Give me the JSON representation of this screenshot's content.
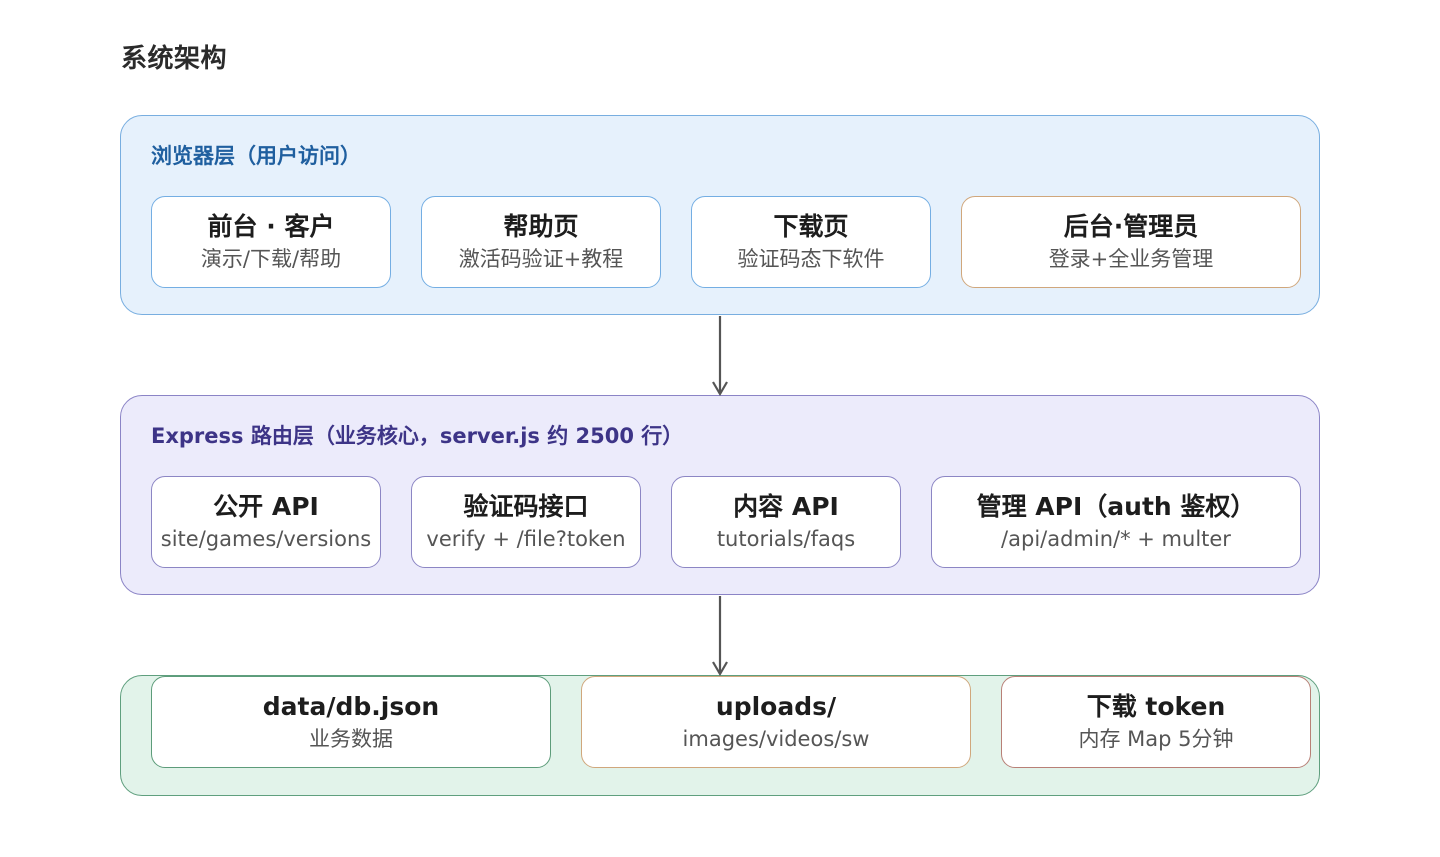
{
  "title": "系统架构",
  "layers": {
    "browser": {
      "title": "浏览器层（用户访问）",
      "nodes": [
        {
          "title": "前台 · 客户",
          "sub": "演示/下载/帮助"
        },
        {
          "title": "帮助页",
          "sub": "激活码验证+教程"
        },
        {
          "title": "下载页",
          "sub": "验证码态下软件"
        },
        {
          "title": "后台·管理员",
          "sub": "登录+全业务管理"
        }
      ]
    },
    "express": {
      "title": "Express 路由层（业务核心，server.js 约 2500 行）",
      "nodes": [
        {
          "title": "公开 API",
          "sub": "site/games/versions"
        },
        {
          "title": "验证码接口",
          "sub": "verify + /file?token"
        },
        {
          "title": "内容 API",
          "sub": "tutorials/faqs"
        },
        {
          "title": "管理 API（auth 鉴权）",
          "sub": "/api/admin/* + multer"
        }
      ]
    },
    "storage": {
      "nodes": [
        {
          "title": "data/db.json",
          "sub": "业务数据"
        },
        {
          "title": "uploads/",
          "sub": "images/videos/sw"
        },
        {
          "title": "下载 token",
          "sub": "内存 Map 5分钟"
        }
      ]
    }
  },
  "colors": {
    "browser_layer_bg": "#e6f1fc",
    "express_layer_bg": "#ecebfb",
    "storage_layer_bg": "#e2f3ea",
    "arrow": "#555555"
  }
}
